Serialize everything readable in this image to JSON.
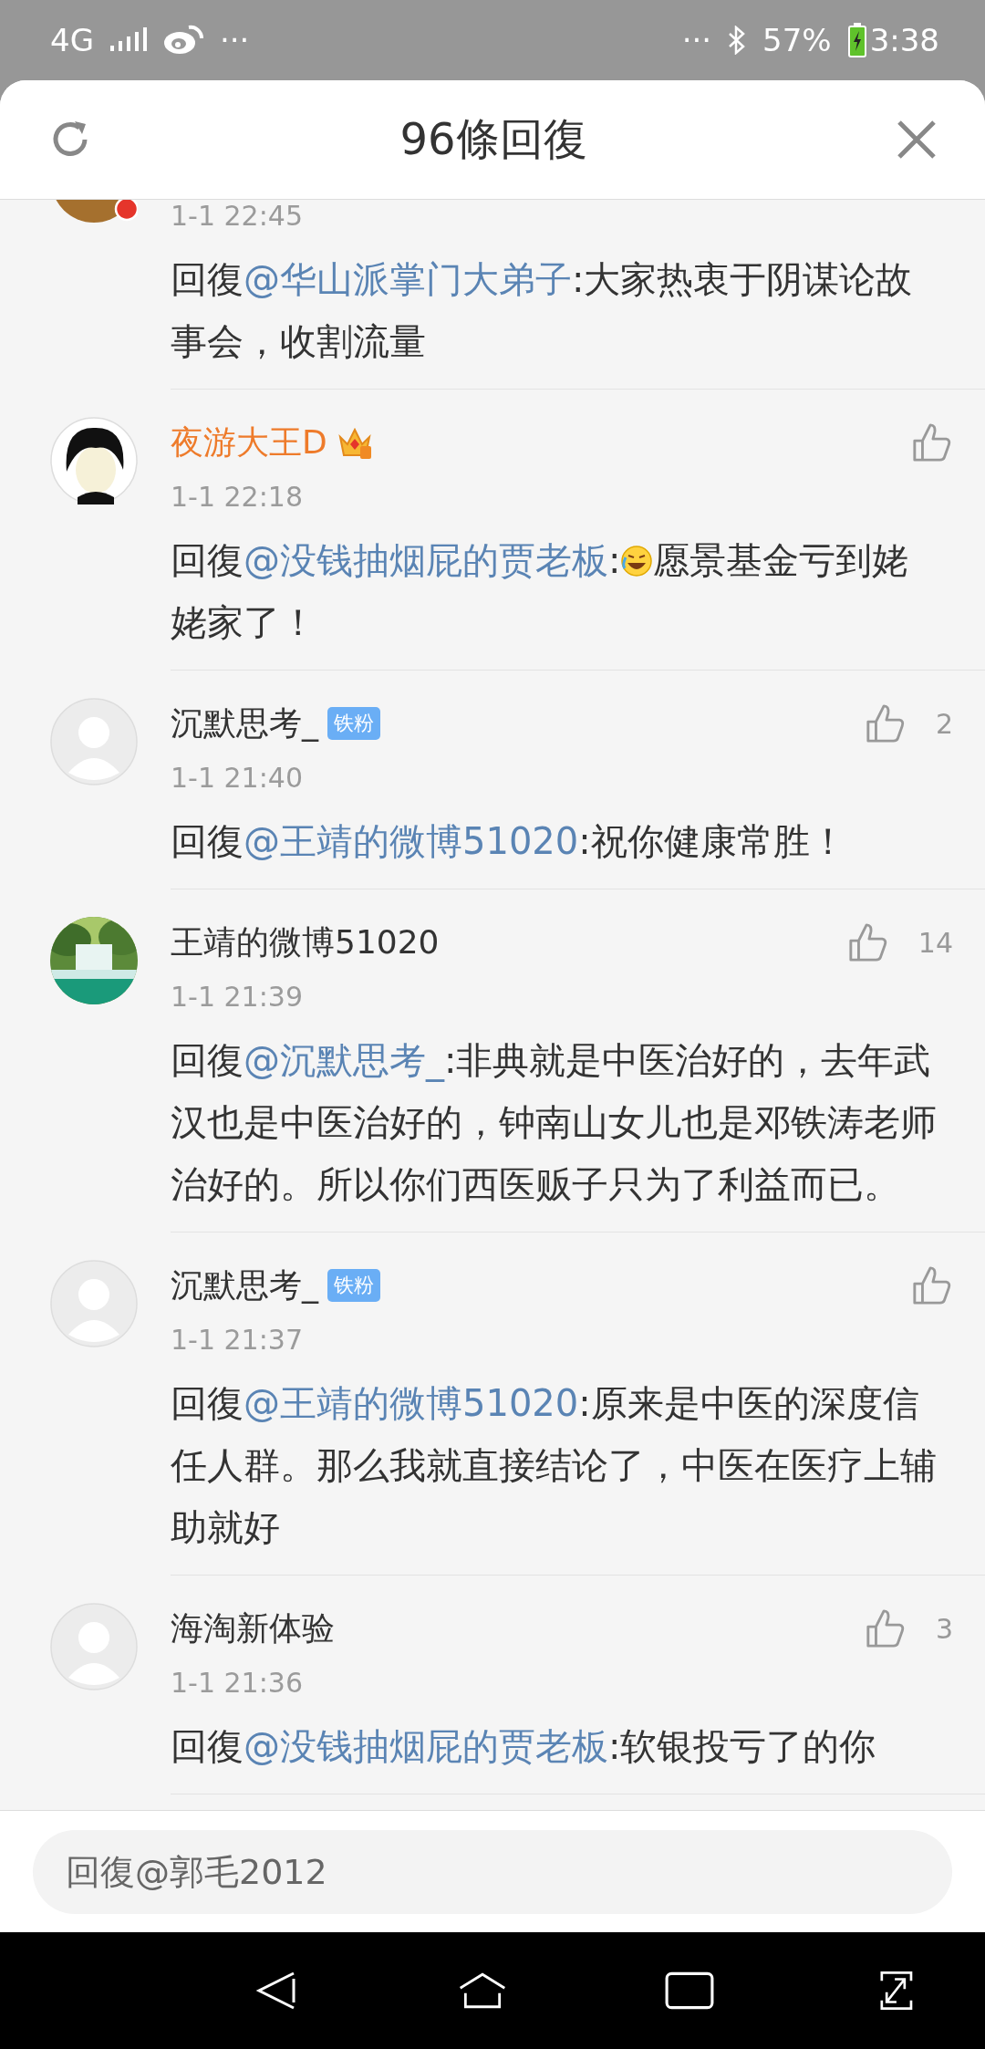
{
  "status_bar": {
    "network": "4G",
    "left_more": "···",
    "right_more": "···",
    "battery": "57%",
    "time": "3:38"
  },
  "header": {
    "title": "96條回復"
  },
  "comments": [
    {
      "time": "1-1 22:45",
      "body": [
        {
          "kind": "text",
          "text": "回復"
        },
        {
          "kind": "mention",
          "text": "@华山派掌门大弟子"
        },
        {
          "kind": "text",
          "text": ":大家热衷于阴谋论故事会，收割流量"
        }
      ]
    },
    {
      "avatar": {
        "kind": "drawn"
      },
      "name": "夜游大王D",
      "vip": true,
      "time": "1-1 22:18",
      "body": [
        {
          "kind": "text",
          "text": "回復"
        },
        {
          "kind": "mention",
          "text": "@没钱抽烟屁的贾老板"
        },
        {
          "kind": "text",
          "text": ":"
        },
        {
          "kind": "emoji"
        },
        {
          "kind": "text",
          "text": "愿景基金亏到姥姥家了！"
        }
      ]
    },
    {
      "avatar": {
        "kind": "default"
      },
      "name": "沉默思考_",
      "vip": false,
      "badge": "铁粉",
      "likes": "2",
      "time": "1-1 21:40",
      "body": [
        {
          "kind": "text",
          "text": "回復"
        },
        {
          "kind": "mention",
          "text": "@王靖的微博51020"
        },
        {
          "kind": "text",
          "text": ":祝你健康常胜！"
        }
      ]
    },
    {
      "name": "王靖的微博51020",
      "vip": false,
      "likes": "14",
      "time": "1-1 21:39",
      "body": [
        {
          "kind": "text",
          "text": "回復"
        },
        {
          "kind": "mention",
          "text": "@沉默思考_"
        },
        {
          "kind": "text",
          "text": ":非典就是中医治好的，去年武汉也是中医治好的，钟南山女儿也是邓铁涛老师治好的。所以你们西医贩子只为了利益而已。"
        }
      ]
    },
    {
      "avatar": {
        "kind": "default"
      },
      "name": "沉默思考_",
      "vip": false,
      "badge": "铁粉",
      "time": "1-1 21:37",
      "body": [
        {
          "kind": "text",
          "text": "回復"
        },
        {
          "kind": "mention",
          "text": "@王靖的微博51020"
        },
        {
          "kind": "text",
          "text": ":原来是中医的深度信任人群。那么我就直接结论了，中医在医疗上辅助就好"
        }
      ]
    },
    {
      "avatar": {
        "kind": "default"
      },
      "name": "海淘新体验",
      "vip": false,
      "likes": "3",
      "time": "1-1 21:36",
      "body": [
        {
          "kind": "text",
          "text": "回復"
        },
        {
          "kind": "mention",
          "text": "@没钱抽烟屁的贾老板"
        },
        {
          "kind": "text",
          "text": ":软银投亏了的你"
        }
      ]
    }
  ],
  "reply_box": {
    "placeholder": "回復@郭毛2012"
  }
}
